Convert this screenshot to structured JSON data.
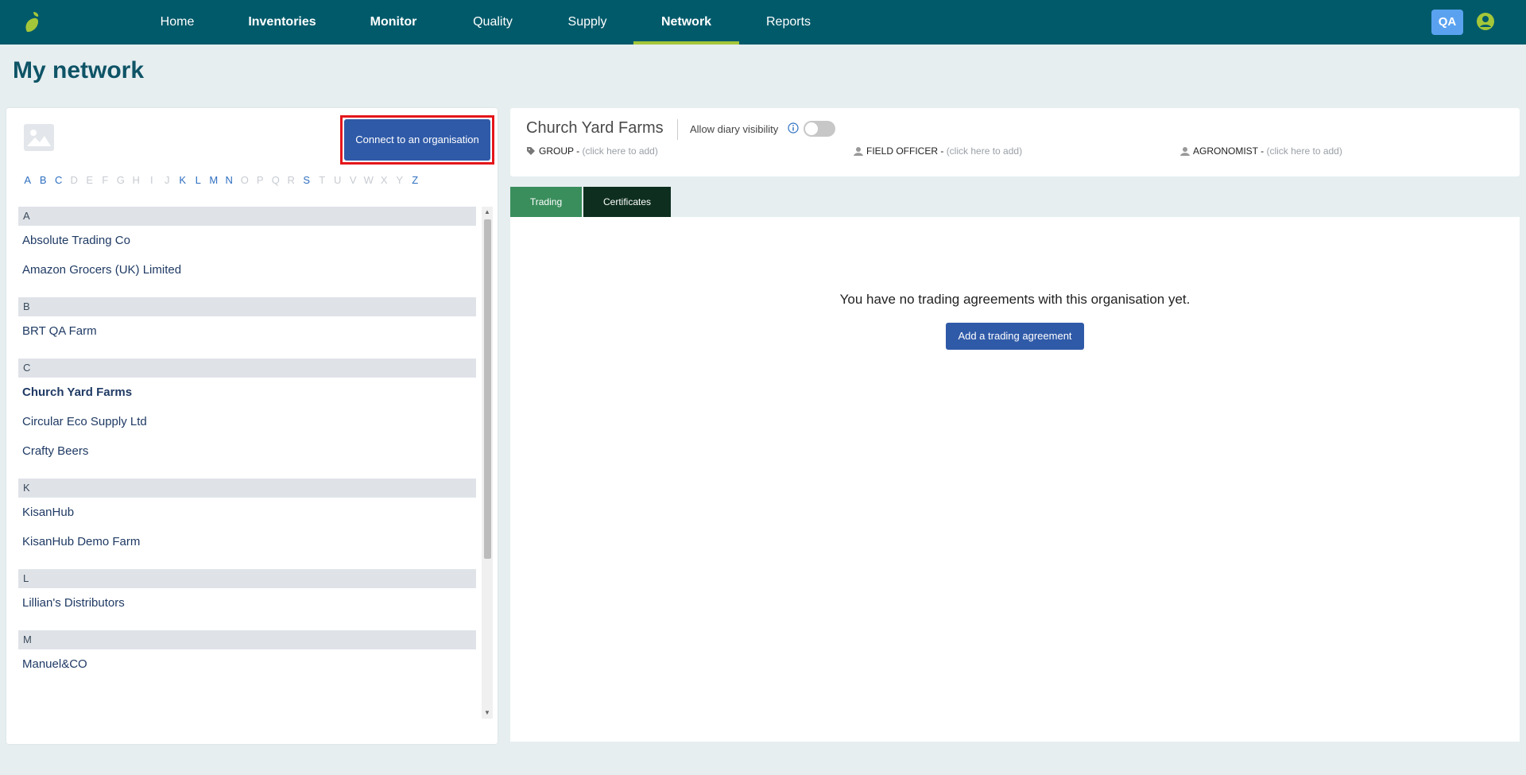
{
  "nav": {
    "items": [
      {
        "label": "Home"
      },
      {
        "label": "Inventories"
      },
      {
        "label": "Monitor"
      },
      {
        "label": "Quality"
      },
      {
        "label": "Supply"
      },
      {
        "label": "Network"
      },
      {
        "label": "Reports"
      }
    ],
    "active": "Network",
    "badge": "QA"
  },
  "page": {
    "title": "My network"
  },
  "left": {
    "connect_label": "Connect to an organisation",
    "alphabet": [
      "A",
      "B",
      "C",
      "D",
      "E",
      "F",
      "G",
      "H",
      "I",
      "J",
      "K",
      "L",
      "M",
      "N",
      "O",
      "P",
      "Q",
      "R",
      "S",
      "T",
      "U",
      "V",
      "W",
      "X",
      "Y",
      "Z"
    ],
    "alphabet_enabled": [
      "A",
      "B",
      "C",
      "K",
      "L",
      "M",
      "N",
      "S",
      "Z"
    ],
    "groups": [
      {
        "letter": "A",
        "orgs": [
          "Absolute Trading Co",
          "Amazon Grocers (UK) Limited"
        ]
      },
      {
        "letter": "B",
        "orgs": [
          "BRT QA Farm"
        ]
      },
      {
        "letter": "C",
        "orgs": [
          "Church Yard Farms",
          "Circular Eco Supply Ltd",
          "Crafty Beers"
        ]
      },
      {
        "letter": "K",
        "orgs": [
          "KisanHub",
          "KisanHub Demo Farm"
        ]
      },
      {
        "letter": "L",
        "orgs": [
          "Lillian's Distributors"
        ]
      },
      {
        "letter": "M",
        "orgs": [
          "Manuel&CO"
        ]
      }
    ],
    "selected": "Church Yard Farms"
  },
  "detail": {
    "org_name": "Church Yard Farms",
    "diary_label": "Allow diary visibility",
    "group_label": "GROUP -",
    "group_hint": "(click here to add)",
    "field_officer_label": "FIELD OFFICER -",
    "field_officer_hint": "(click here to add)",
    "agronomist_label": "AGRONOMIST -",
    "agronomist_hint": "(click here to add)",
    "tabs": [
      "Trading",
      "Certificates"
    ],
    "empty_message": "You have no trading agreements with this organisation yet.",
    "add_button": "Add a trading agreement"
  },
  "colors": {
    "topbar": "#005a6a",
    "nav_active_underline": "#a4c639",
    "primary_button": "#2f5aa8",
    "highlight_border": "#e4161b",
    "tab_trading": "#3a8e5c",
    "tab_certificates": "#0e2f1f"
  }
}
